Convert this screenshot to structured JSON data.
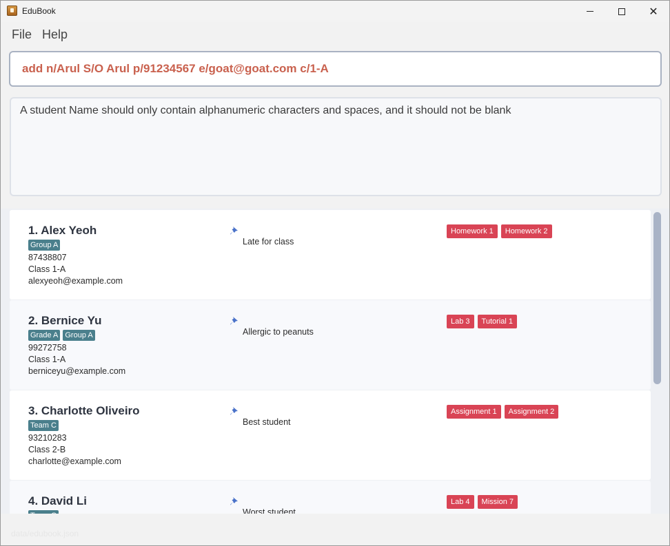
{
  "window": {
    "title": "EduBook"
  },
  "menu": {
    "file": "File",
    "help": "Help"
  },
  "command": {
    "value": "add n/Arul S/O Arul p/91234567 e/goat@goat.com c/1-A"
  },
  "result": {
    "message": "A student Name should only contain alphanumeric characters and spaces, and it should not be blank"
  },
  "students": [
    {
      "name": "1. Alex Yeoh",
      "groups": [
        "Group A"
      ],
      "phone": "87438807",
      "class": "Class 1-A",
      "email": "alexyeoh@example.com",
      "note": "Late for class",
      "tags": [
        "Homework 1",
        "Homework 2"
      ]
    },
    {
      "name": "2. Bernice Yu",
      "groups": [
        "Grade A",
        "Group A"
      ],
      "phone": "99272758",
      "class": "Class 1-A",
      "email": "berniceyu@example.com",
      "note": "Allergic to peanuts",
      "tags": [
        "Lab 3",
        "Tutorial 1"
      ]
    },
    {
      "name": "3. Charlotte Oliveiro",
      "groups": [
        "Team C"
      ],
      "phone": "93210283",
      "class": "Class 2-B",
      "email": "charlotte@example.com",
      "note": "Best student",
      "tags": [
        "Assignment 1",
        "Assignment 2"
      ]
    },
    {
      "name": "4. David Li",
      "groups": [
        "Team C"
      ],
      "phone": "",
      "class": "",
      "email": "",
      "note": "Worst student",
      "tags": [
        "Lab 4",
        "Mission 7"
      ]
    }
  ],
  "status": {
    "text": "data/edubook.json"
  },
  "colors": {
    "command_text": "#c9614e",
    "group_tag": "#4a7f8c",
    "red_tag": "#d94455",
    "scroll_thumb": "#a9b3c6"
  }
}
